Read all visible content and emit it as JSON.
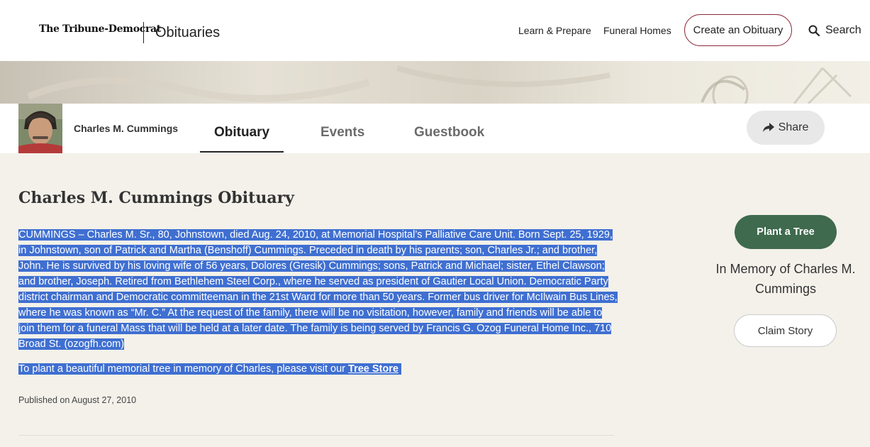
{
  "header": {
    "brand": "The Tribune-Democrat",
    "section": "Obituaries",
    "nav": [
      "Learn & Prepare",
      "Funeral Homes"
    ],
    "create_label": "Create an Obituary",
    "search_label": "Search"
  },
  "profile": {
    "name": "Charles M. Cummings",
    "tabs": [
      "Obituary",
      "Events",
      "Guestbook"
    ],
    "active_tab": "Obituary",
    "share_label": "Share"
  },
  "obituary": {
    "title": "Charles M. Cummings Obituary",
    "body": "CUMMINGS – Charles M. Sr., 80, Johnstown, died Aug. 24, 2010, at Memorial Hospital’s Palliative Care Unit. Born Sept. 25, 1929, in Johnstown, son of Patrick and Martha (Benshoff) Cummings. Preceded in death by his parents; son, Charles Jr.; and brother, John. He is survived by his loving wife of 56 years, Dolores (Gresik) Cummings; sons, Patrick and Michael; sister, Ethel Clawson; and brother, Joseph. Retired from Bethlehem Steel Corp., where he served as president of Gautier Local Union. Democratic Party district chairman and Democratic committeeman in the 21st Ward for more than 50 years. Former bus driver for McIlwain Bus Lines, where he was known as “Mr. C.”  At the request of the family, there will be no visitation, however, family and friends will be able to join them for a funeral Mass that will be held at a later date. The family is being served by Francis G. Ozog Funeral Home Inc., 710 Broad St. (ozogfh.com)",
    "tree_text": "To plant a beautiful memorial tree in memory of Charles, please visit our",
    "tree_link": "Tree Store",
    "published": "Published on August 27, 2010"
  },
  "sidebar": {
    "plant_label": "Plant a Tree",
    "memory_text": "In Memory of Charles M. Cummings",
    "claim_label": "Claim Story"
  },
  "colors": {
    "accent_maroon": "#8a2a3b",
    "plant_green": "#3f6a4e",
    "selection_blue": "#3f6fd1",
    "page_bg": "#f3f1ea"
  }
}
